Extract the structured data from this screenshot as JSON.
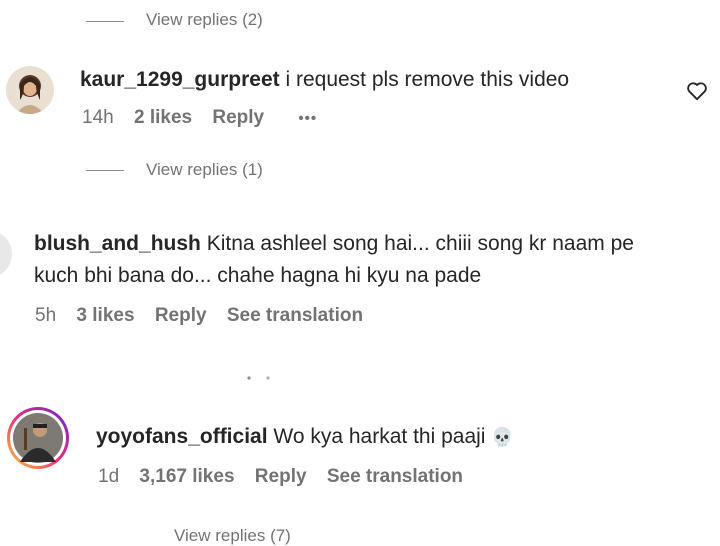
{
  "comments": [
    {
      "view_replies_above": "View replies (2)"
    },
    {
      "username": "kaur_1299_gurpreet",
      "text": "i request pls remove this video",
      "time": "14h",
      "likes": "2 likes",
      "reply": "Reply",
      "more": "•••",
      "view_replies": "View replies (1)",
      "avatar_icon": "user-avatar-photo",
      "like_icon": "heart-outline-icon"
    },
    {
      "username": "blush_and_hush",
      "text_line1": "Kitna ashleel song hai... chiii song kr naam pe",
      "text_line2": "kuch bhi bana do... chahe hagna hi kyu na pade",
      "time": "5h",
      "likes": "3 likes",
      "reply": "Reply",
      "see_translation": "See translation"
    },
    {
      "username": "yoyofans_official",
      "text": "Wo kya harkat thi paaji",
      "emoji": "💀",
      "time": "1d",
      "likes": "3,167 likes",
      "reply": "Reply",
      "see_translation": "See translation",
      "view_replies": "View replies (7)",
      "avatar_icon": "story-ring-avatar"
    }
  ],
  "colors": {
    "text": "#262626",
    "muted": "#737373",
    "story_ring_start": "#f9ce34",
    "story_ring_mid": "#ee2a7b",
    "story_ring_end": "#6228d7"
  }
}
